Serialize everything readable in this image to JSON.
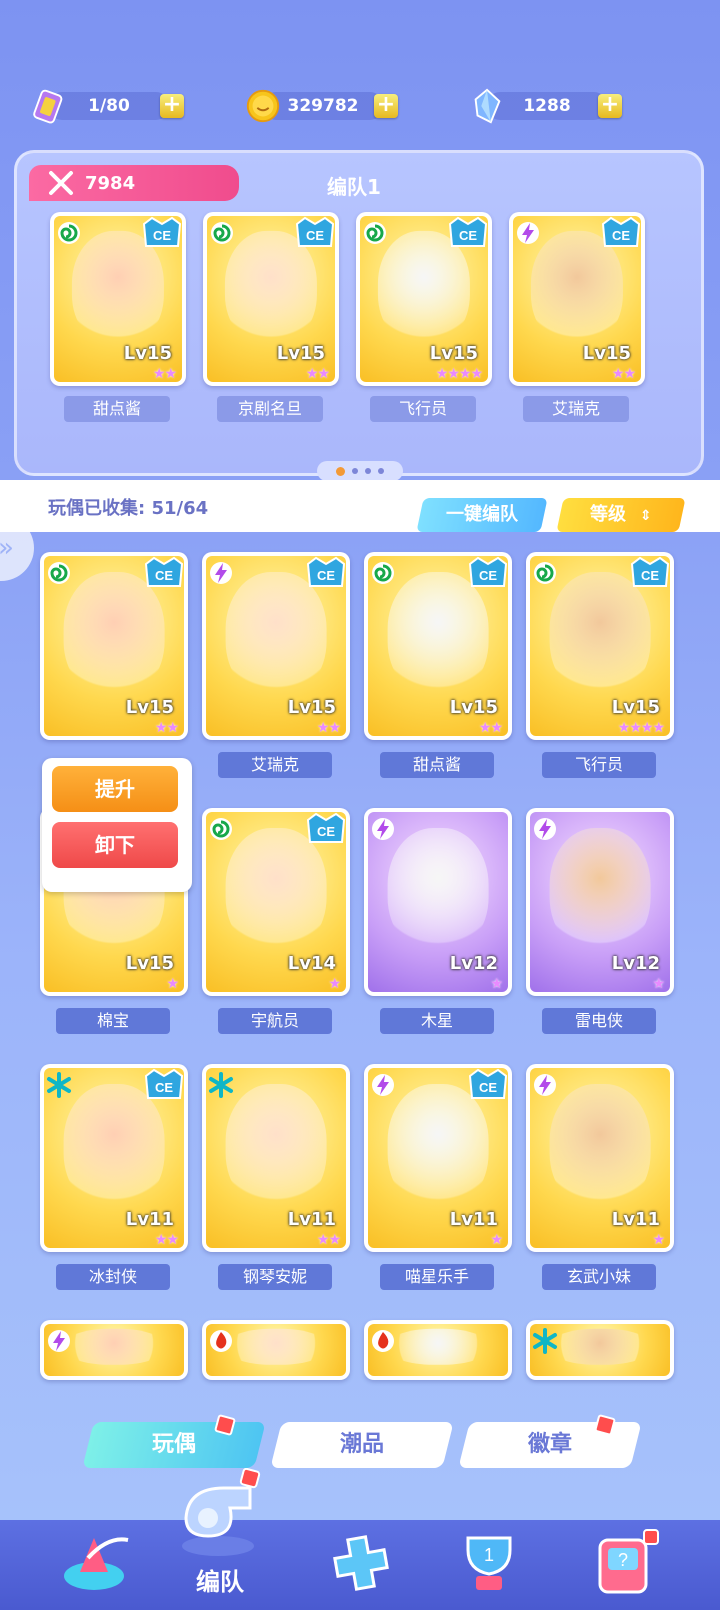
{
  "resources": {
    "tickets": "1/80",
    "coins": "329782",
    "gems": "1288"
  },
  "team": {
    "power": "7984",
    "title": "编队1",
    "members": [
      {
        "name": "甜点酱",
        "level": "Lv15",
        "stars": "★★",
        "element": "wind",
        "ce": true
      },
      {
        "name": "京剧名旦",
        "level": "Lv15",
        "stars": "★★",
        "element": "wind",
        "ce": true
      },
      {
        "name": "飞行员",
        "level": "Lv15",
        "stars": "★★★★",
        "element": "wind",
        "ce": true
      },
      {
        "name": "艾瑞克",
        "level": "Lv15",
        "stars": "★★",
        "element": "thunder",
        "ce": true
      }
    ],
    "page_dots": 4,
    "active_dot": 0
  },
  "collection": {
    "label": "玩偶已收集: 51/64",
    "one_click_team": "一键编队",
    "sort_label": "等级"
  },
  "popup": {
    "upgrade": "提升",
    "remove": "卸下"
  },
  "dolls": [
    {
      "name": "",
      "level": "Lv15",
      "stars": "★★",
      "element": "wind",
      "ce": true
    },
    {
      "name": "艾瑞克",
      "level": "Lv15",
      "stars": "★★",
      "element": "thunder",
      "ce": true
    },
    {
      "name": "甜点酱",
      "level": "Lv15",
      "stars": "★★",
      "element": "wind",
      "ce": true
    },
    {
      "name": "飞行员",
      "level": "Lv15",
      "stars": "★★★★",
      "element": "wind",
      "ce": true
    },
    {
      "name": "棉宝",
      "level": "Lv15",
      "stars": "★",
      "element": "",
      "ce": false
    },
    {
      "name": "宇航员",
      "level": "Lv14",
      "stars": "★",
      "element": "wind",
      "ce": true
    },
    {
      "name": "木星",
      "level": "Lv12",
      "stars": "★",
      "element": "thunder",
      "ce": false
    },
    {
      "name": "雷电侠",
      "level": "Lv12",
      "stars": "★",
      "element": "thunder",
      "ce": false
    },
    {
      "name": "冰封侠",
      "level": "Lv11",
      "stars": "★★",
      "element": "ice",
      "ce": true
    },
    {
      "name": "钢琴安妮",
      "level": "Lv11",
      "stars": "★★",
      "element": "ice",
      "ce": false
    },
    {
      "name": "喵星乐手",
      "level": "Lv11",
      "stars": "★",
      "element": "thunder",
      "ce": true
    },
    {
      "name": "玄武小妹",
      "level": "Lv11",
      "stars": "★",
      "element": "thunder",
      "ce": false
    },
    {
      "name": "",
      "level": "",
      "stars": "",
      "element": "thunder",
      "ce": false
    },
    {
      "name": "",
      "level": "",
      "stars": "",
      "element": "fire",
      "ce": false
    },
    {
      "name": "",
      "level": "",
      "stars": "",
      "element": "fire",
      "ce": false
    },
    {
      "name": "",
      "level": "",
      "stars": "",
      "element": "ice",
      "ce": false
    }
  ],
  "bottom_tabs": [
    "玩偶",
    "潮品",
    "徽章"
  ],
  "nav": {
    "active_label": "编队"
  },
  "colors": {
    "accent_pink": "#f04c8d",
    "accent_cyan": "#54b8ff",
    "accent_yellow": "#ffb61c",
    "element_wind": "#18a84a",
    "element_thunder": "#b24bea",
    "element_ice": "#0fb6c6",
    "element_fire": "#e5321d"
  }
}
